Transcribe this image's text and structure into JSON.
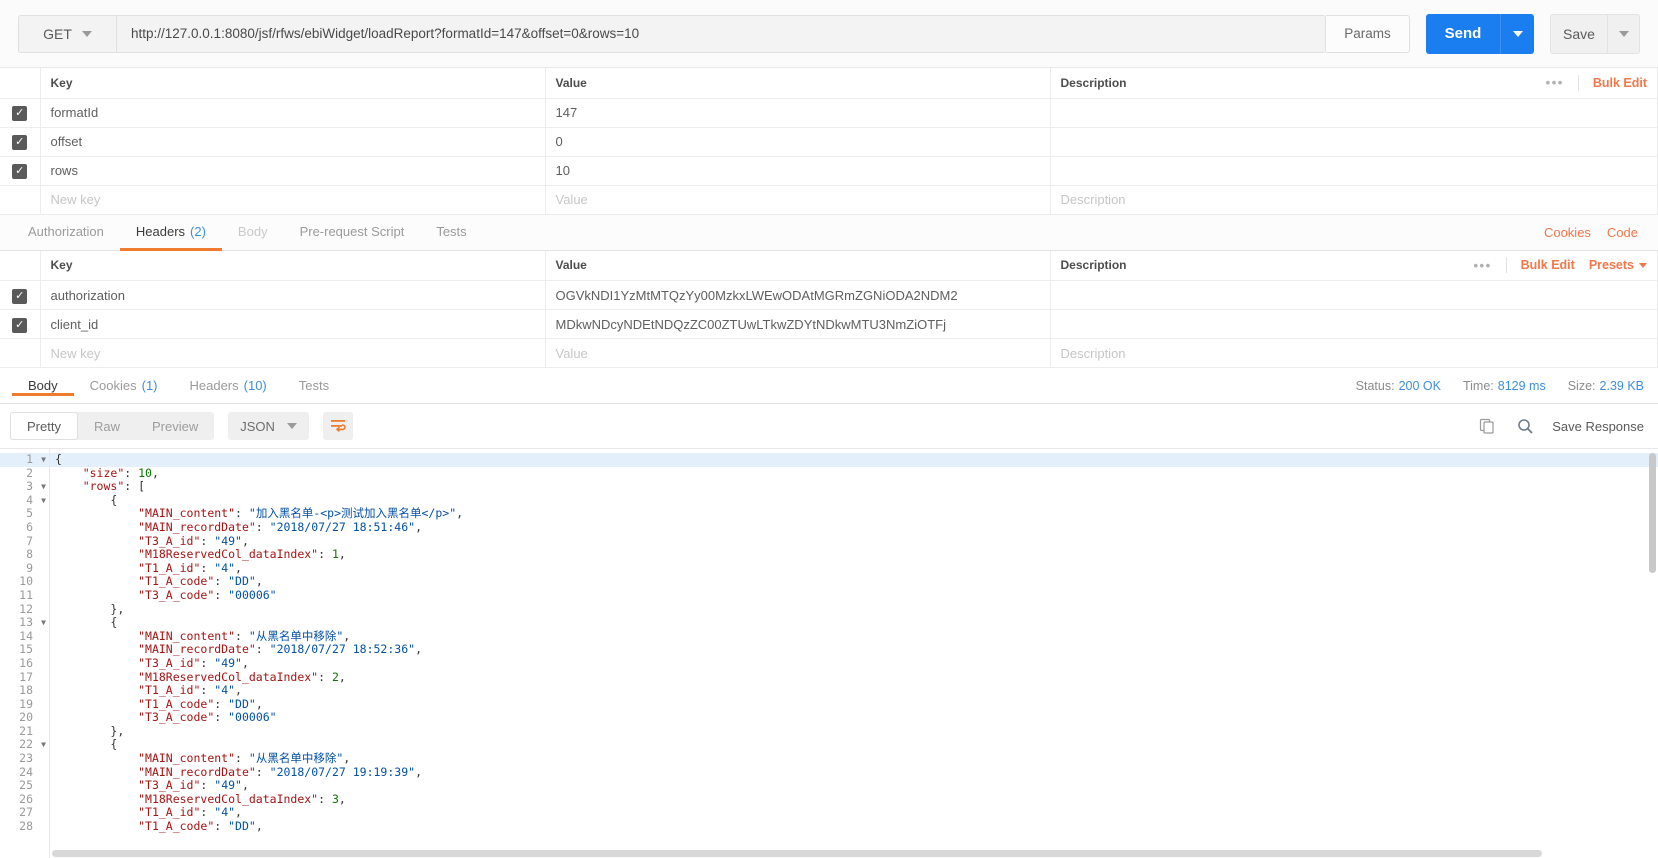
{
  "request": {
    "method": "GET",
    "url": "http://127.0.0.1:8080/jsf/rfws/ebiWidget/loadReport?formatId=147&offset=0&rows=10",
    "params_label": "Params",
    "send_label": "Send",
    "save_label": "Save"
  },
  "params_table": {
    "headers": {
      "key": "Key",
      "value": "Value",
      "description": "Description"
    },
    "bulk_edit": "Bulk Edit",
    "dots": "•••",
    "rows": [
      {
        "checked": true,
        "key": "formatId",
        "value": "147",
        "description": ""
      },
      {
        "checked": true,
        "key": "offset",
        "value": "0",
        "description": ""
      },
      {
        "checked": true,
        "key": "rows",
        "value": "10",
        "description": ""
      }
    ],
    "placeholder_row": {
      "key": "New key",
      "value": "Value",
      "description": "Description"
    }
  },
  "request_tabs": {
    "items": [
      {
        "label": "Authorization",
        "count": "",
        "active": false,
        "dim": false
      },
      {
        "label": "Headers",
        "count": "(2)",
        "active": true,
        "dim": false
      },
      {
        "label": "Body",
        "count": "",
        "active": false,
        "dim": true
      },
      {
        "label": "Pre-request Script",
        "count": "",
        "active": false,
        "dim": false
      },
      {
        "label": "Tests",
        "count": "",
        "active": false,
        "dim": false
      }
    ],
    "cookies_link": "Cookies",
    "code_link": "Code"
  },
  "headers_table": {
    "headers": {
      "key": "Key",
      "value": "Value",
      "description": "Description"
    },
    "bulk_edit": "Bulk Edit",
    "presets": "Presets",
    "dots": "•••",
    "rows": [
      {
        "checked": true,
        "key": "authorization",
        "value": "OGVkNDI1YzMtMTQzYy00MzkxLWEwODAtMGRmZGNiODA2NDM2",
        "description": ""
      },
      {
        "checked": true,
        "key": "client_id",
        "value": "MDkwNDcyNDEtNDQzZC00ZTUwLTkwZDYtNDkwMTU3NmZiOTFj",
        "description": ""
      }
    ],
    "placeholder_row": {
      "key": "New key",
      "value": "Value",
      "description": "Description"
    }
  },
  "response_tabs": {
    "items": [
      {
        "label": "Body",
        "count": "",
        "active": true
      },
      {
        "label": "Cookies",
        "count": "(1)",
        "active": false
      },
      {
        "label": "Headers",
        "count": "(10)",
        "active": false
      },
      {
        "label": "Tests",
        "count": "",
        "active": false
      }
    ],
    "status_label": "Status:",
    "status_value": "200 OK",
    "time_label": "Time:",
    "time_value": "8129 ms",
    "size_label": "Size:",
    "size_value": "2.39 KB"
  },
  "response_toolbar": {
    "view_modes": [
      "Pretty",
      "Raw",
      "Preview"
    ],
    "active_view": "Pretty",
    "format": "JSON",
    "wrap_icon": "word-wrap-icon",
    "copy_icon": "copy-icon",
    "search_icon": "search-icon",
    "save_response": "Save Response"
  },
  "colors": {
    "accent_orange": "#f2784b",
    "send_blue": "#1a7ef0",
    "link_blue": "#3f8fe0",
    "string_blue": "#0451a5",
    "key_red": "#a31515",
    "number_green": "#0b7500"
  },
  "code_body": {
    "language": "json",
    "highlighted_line": 1,
    "lines": [
      {
        "n": 1,
        "fold": true,
        "indent": 0,
        "tokens": [
          [
            "p",
            "{"
          ]
        ]
      },
      {
        "n": 2,
        "fold": false,
        "indent": 2,
        "tokens": [
          [
            "k",
            "\"size\""
          ],
          [
            "p",
            ": "
          ],
          [
            "n",
            "10"
          ],
          [
            "p",
            ","
          ]
        ]
      },
      {
        "n": 3,
        "fold": true,
        "indent": 2,
        "tokens": [
          [
            "k",
            "\"rows\""
          ],
          [
            "p",
            ": ["
          ]
        ]
      },
      {
        "n": 4,
        "fold": true,
        "indent": 4,
        "tokens": [
          [
            "p",
            "{"
          ]
        ]
      },
      {
        "n": 5,
        "fold": false,
        "indent": 6,
        "tokens": [
          [
            "k",
            "\"MAIN_content\""
          ],
          [
            "p",
            ": "
          ],
          [
            "s",
            "\"加入黑名单-<p>测试加入黑名单</p>\""
          ],
          [
            "p",
            ","
          ]
        ]
      },
      {
        "n": 6,
        "fold": false,
        "indent": 6,
        "tokens": [
          [
            "k",
            "\"MAIN_recordDate\""
          ],
          [
            "p",
            ": "
          ],
          [
            "s",
            "\"2018/07/27 18:51:46\""
          ],
          [
            "p",
            ","
          ]
        ]
      },
      {
        "n": 7,
        "fold": false,
        "indent": 6,
        "tokens": [
          [
            "k",
            "\"T3_A_id\""
          ],
          [
            "p",
            ": "
          ],
          [
            "s",
            "\"49\""
          ],
          [
            "p",
            ","
          ]
        ]
      },
      {
        "n": 8,
        "fold": false,
        "indent": 6,
        "tokens": [
          [
            "k",
            "\"M18ReservedCol_dataIndex\""
          ],
          [
            "p",
            ": "
          ],
          [
            "n",
            "1"
          ],
          [
            "p",
            ","
          ]
        ]
      },
      {
        "n": 9,
        "fold": false,
        "indent": 6,
        "tokens": [
          [
            "k",
            "\"T1_A_id\""
          ],
          [
            "p",
            ": "
          ],
          [
            "s",
            "\"4\""
          ],
          [
            "p",
            ","
          ]
        ]
      },
      {
        "n": 10,
        "fold": false,
        "indent": 6,
        "tokens": [
          [
            "k",
            "\"T1_A_code\""
          ],
          [
            "p",
            ": "
          ],
          [
            "s",
            "\"DD\""
          ],
          [
            "p",
            ","
          ]
        ]
      },
      {
        "n": 11,
        "fold": false,
        "indent": 6,
        "tokens": [
          [
            "k",
            "\"T3_A_code\""
          ],
          [
            "p",
            ": "
          ],
          [
            "s",
            "\"00006\""
          ]
        ]
      },
      {
        "n": 12,
        "fold": false,
        "indent": 4,
        "tokens": [
          [
            "p",
            "},"
          ]
        ]
      },
      {
        "n": 13,
        "fold": true,
        "indent": 4,
        "tokens": [
          [
            "p",
            "{"
          ]
        ]
      },
      {
        "n": 14,
        "fold": false,
        "indent": 6,
        "tokens": [
          [
            "k",
            "\"MAIN_content\""
          ],
          [
            "p",
            ": "
          ],
          [
            "s",
            "\"从黑名单中移除\""
          ],
          [
            "p",
            ","
          ]
        ]
      },
      {
        "n": 15,
        "fold": false,
        "indent": 6,
        "tokens": [
          [
            "k",
            "\"MAIN_recordDate\""
          ],
          [
            "p",
            ": "
          ],
          [
            "s",
            "\"2018/07/27 18:52:36\""
          ],
          [
            "p",
            ","
          ]
        ]
      },
      {
        "n": 16,
        "fold": false,
        "indent": 6,
        "tokens": [
          [
            "k",
            "\"T3_A_id\""
          ],
          [
            "p",
            ": "
          ],
          [
            "s",
            "\"49\""
          ],
          [
            "p",
            ","
          ]
        ]
      },
      {
        "n": 17,
        "fold": false,
        "indent": 6,
        "tokens": [
          [
            "k",
            "\"M18ReservedCol_dataIndex\""
          ],
          [
            "p",
            ": "
          ],
          [
            "n",
            "2"
          ],
          [
            "p",
            ","
          ]
        ]
      },
      {
        "n": 18,
        "fold": false,
        "indent": 6,
        "tokens": [
          [
            "k",
            "\"T1_A_id\""
          ],
          [
            "p",
            ": "
          ],
          [
            "s",
            "\"4\""
          ],
          [
            "p",
            ","
          ]
        ]
      },
      {
        "n": 19,
        "fold": false,
        "indent": 6,
        "tokens": [
          [
            "k",
            "\"T1_A_code\""
          ],
          [
            "p",
            ": "
          ],
          [
            "s",
            "\"DD\""
          ],
          [
            "p",
            ","
          ]
        ]
      },
      {
        "n": 20,
        "fold": false,
        "indent": 6,
        "tokens": [
          [
            "k",
            "\"T3_A_code\""
          ],
          [
            "p",
            ": "
          ],
          [
            "s",
            "\"00006\""
          ]
        ]
      },
      {
        "n": 21,
        "fold": false,
        "indent": 4,
        "tokens": [
          [
            "p",
            "},"
          ]
        ]
      },
      {
        "n": 22,
        "fold": true,
        "indent": 4,
        "tokens": [
          [
            "p",
            "{"
          ]
        ]
      },
      {
        "n": 23,
        "fold": false,
        "indent": 6,
        "tokens": [
          [
            "k",
            "\"MAIN_content\""
          ],
          [
            "p",
            ": "
          ],
          [
            "s",
            "\"从黑名单中移除\""
          ],
          [
            "p",
            ","
          ]
        ]
      },
      {
        "n": 24,
        "fold": false,
        "indent": 6,
        "tokens": [
          [
            "k",
            "\"MAIN_recordDate\""
          ],
          [
            "p",
            ": "
          ],
          [
            "s",
            "\"2018/07/27 19:19:39\""
          ],
          [
            "p",
            ","
          ]
        ]
      },
      {
        "n": 25,
        "fold": false,
        "indent": 6,
        "tokens": [
          [
            "k",
            "\"T3_A_id\""
          ],
          [
            "p",
            ": "
          ],
          [
            "s",
            "\"49\""
          ],
          [
            "p",
            ","
          ]
        ]
      },
      {
        "n": 26,
        "fold": false,
        "indent": 6,
        "tokens": [
          [
            "k",
            "\"M18ReservedCol_dataIndex\""
          ],
          [
            "p",
            ": "
          ],
          [
            "n",
            "3"
          ],
          [
            "p",
            ","
          ]
        ]
      },
      {
        "n": 27,
        "fold": false,
        "indent": 6,
        "tokens": [
          [
            "k",
            "\"T1_A_id\""
          ],
          [
            "p",
            ": "
          ],
          [
            "s",
            "\"4\""
          ],
          [
            "p",
            ","
          ]
        ]
      },
      {
        "n": 28,
        "fold": false,
        "indent": 6,
        "tokens": [
          [
            "k",
            "\"T1_A_code\""
          ],
          [
            "p",
            ": "
          ],
          [
            "s",
            "\"DD\""
          ],
          [
            "p",
            ","
          ]
        ]
      }
    ]
  }
}
